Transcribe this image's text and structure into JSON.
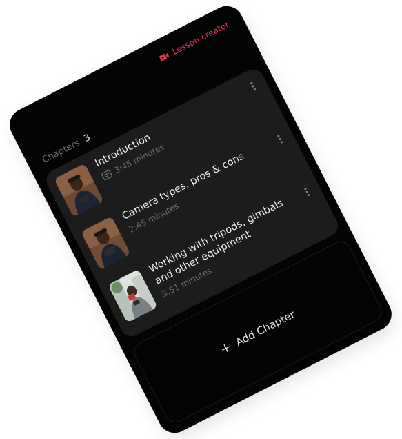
{
  "header": {
    "lesson_creator_label": "Lesson creator",
    "lesson_creator_icon": "video-camera-icon",
    "accent_color": "#e8364a"
  },
  "chapters": {
    "label": "Chapters",
    "count": "3",
    "items": [
      {
        "title": "Introduction",
        "duration": "3:45 minutes",
        "meta_icon": "slides-icon",
        "thumb_icon": "person-photo-icon"
      },
      {
        "title": "Camera types, pros & cons",
        "duration": "2:45 minutes",
        "thumb_icon": "person-photo-icon"
      },
      {
        "title": "Working with tripods, gimbals and other equipment",
        "duration": "3:51 minutes",
        "thumb_icon": "outdoor-photo-icon"
      }
    ],
    "more_icon": "more-vertical-icon"
  },
  "add_chapter": {
    "label": "Add Chapter",
    "icon": "plus-icon"
  }
}
